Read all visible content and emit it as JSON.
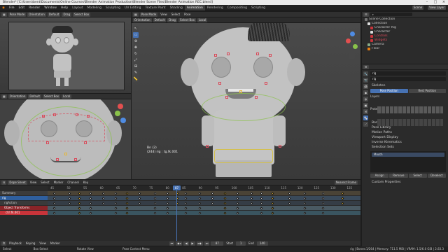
{
  "window": {
    "title": "Blender* [C:\\Users\\bent\\Documents\\Online Courses\\Blender Animation Production\\Blender Scene Files\\Blender Animation REC.blend]",
    "controls": [
      "–",
      "□",
      "×"
    ]
  },
  "menubar": {
    "items": [
      "File",
      "Edit",
      "Render",
      "Window",
      "Help"
    ],
    "workspaces": [
      "Layout",
      "Modeling",
      "Sculpting",
      "UV Editing",
      "Texture Paint",
      "Shading",
      "Animation",
      "Rendering",
      "Compositing",
      "Scripting"
    ],
    "active_workspace": "Animation",
    "scene_label": "Scene",
    "view_layer_label": "View Layer"
  },
  "cam_view": {
    "mode": "Pose Mode",
    "orientation": "Orientation",
    "pivot": "Default",
    "snap": "Drag",
    "select": "Select Box"
  },
  "main_view": {
    "mode": "Pose Mode",
    "menus": [
      "View",
      "Select",
      "Pose"
    ],
    "orientation": "Orientation",
    "pivot": "Default",
    "snap": "Drag",
    "select": "Select Box",
    "transform": "Local",
    "info_line1": "Bn (2)",
    "info_line2": "(244) rig : tg.fk.001"
  },
  "face_view": {
    "orientation": "Orientation",
    "pivot": "Default",
    "select": "Select Box",
    "transform": "Local"
  },
  "dopesheet": {
    "editor": "Dope Sheet",
    "menus": [
      "View",
      "Select",
      "Marker",
      "Channel",
      "Key"
    ],
    "rows": [
      "Summary",
      "rig",
      "rigAction",
      "Object Transforms",
      "ctrl.fk.001"
    ],
    "frame_numbers": [
      "45",
      "50",
      "55",
      "60",
      "65",
      "70",
      "75",
      "80",
      "85",
      "90",
      "95",
      "100",
      "105",
      "110",
      "115",
      "120",
      "125",
      "130",
      "135"
    ],
    "current_frame": "87",
    "keyframes_label": "Nearest Frame"
  },
  "timeline": {
    "playback": "Playback",
    "keying": "Keying",
    "view": "View",
    "marker": "Marker",
    "frame": "87",
    "start_label": "Start",
    "start": "1",
    "end_label": "End",
    "end": "140"
  },
  "outliner": {
    "title": "Scene Collection",
    "rows": [
      "Collection",
      "Character Rig",
      "Character",
      "Controls",
      "Widgets",
      "Camera",
      "Floor"
    ]
  },
  "properties": {
    "bone_name": "rig",
    "armature_name": "rig",
    "sections": [
      "Skeleton",
      "Bone Groups",
      "Pose Library",
      "Motion Paths",
      "Viewport Display",
      "Inverse Kinematics",
      "Selection Sets",
      "Custom Properties"
    ],
    "pose_position": "Pose Position",
    "rest_position": "Rest Position",
    "layers_label": "Layers",
    "protected_label": "Protected Layers",
    "selection_set": "Mouth",
    "buttons": [
      "Assign",
      "Remove",
      "Select",
      "Deselect"
    ]
  },
  "statusbar": {
    "left": [
      "Select",
      "Box Select",
      "Rotate View",
      "Pose Context Menu"
    ],
    "right": "rig | Bones:1/264 | Memory: 711.5 MiB | VRAM: 1.5/6.0 GiB | 2.83.3"
  },
  "colors": {
    "accent": "#4772b3",
    "pose_point": "#d94a5a",
    "pose_point_selected": "#e4b73a",
    "playhead": "#4772b3",
    "keyframe_selected": "#f0c040",
    "row_red": "#c8343a",
    "row_blue": "#2f5f9e"
  }
}
